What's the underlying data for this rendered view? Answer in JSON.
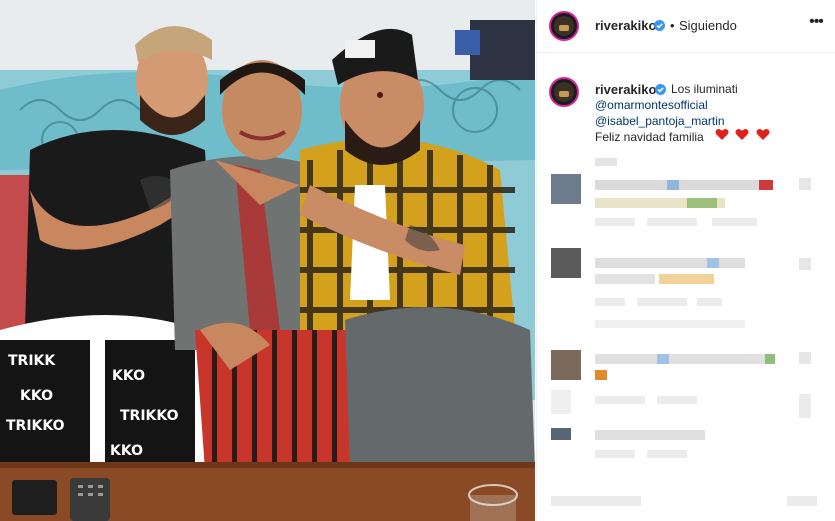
{
  "header": {
    "username": "riverakiko",
    "separator": "•",
    "follow_status": "Siguiendo",
    "more_icon": "ellipsis-icon"
  },
  "caption": {
    "username": "riverakiko",
    "text": "Los iluminati",
    "mentions": [
      "@omarmontesofficial",
      "@isabel_pantoja_martin"
    ],
    "line": "Feliz navidad familia",
    "emoji": "red-heart-icon",
    "heart_count": 3,
    "heart_color": "#e0221f"
  },
  "colors": {
    "verified": "#3897f0",
    "link": "#00376b",
    "text": "#262626",
    "divider": "#efefef"
  }
}
